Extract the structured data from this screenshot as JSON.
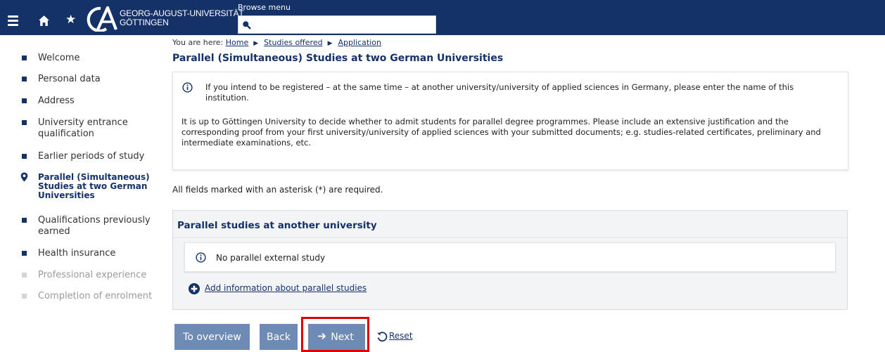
{
  "header": {
    "university_name_line1": "GEORG-AUGUST-UNIVERSITÄT",
    "university_name_line2": "GÖTTINGEN",
    "browse_label": "Browse menu",
    "search_value": "",
    "logo_icon": "university-logo",
    "home_icon": "home-icon",
    "favorite_icon": "star-icon",
    "menu_icon": "hamburger-icon"
  },
  "breadcrumb": {
    "prefix": "You are here:",
    "items": [
      "Home",
      "Studies offered",
      "Application"
    ]
  },
  "page": {
    "title": "Parallel (Simultaneous) Studies at two German Universities",
    "required_note": "All fields marked with an asterisk (*) are required."
  },
  "sidebar": {
    "items": [
      {
        "label": "Welcome",
        "state": "done"
      },
      {
        "label": "Personal data",
        "state": "done"
      },
      {
        "label": "Address",
        "state": "done"
      },
      {
        "label": "University entrance qualification",
        "state": "done"
      },
      {
        "label": "Earlier periods of study",
        "state": "done"
      },
      {
        "label": "Parallel (Simultaneous) Studies at two German Universities",
        "state": "current"
      },
      {
        "label": "Qualifications previously earned",
        "state": "done"
      },
      {
        "label": "Health insurance",
        "state": "done"
      },
      {
        "label": "Professional experience",
        "state": "disabled"
      },
      {
        "label": "Completion of enrolment",
        "state": "disabled"
      }
    ]
  },
  "info_panel": {
    "text1": "If you intend to be registered – at the same time – at another university/university of applied sciences in Germany, please enter the name of this institution.",
    "text2": "It is up to Göttingen University to decide whether to admit students for parallel degree programmes. Please include an extensive justification and the corresponding proof from your first university/university of applied sciences with your submitted documents; e.g. studies-related certificates, preliminary and intermediate examinations, etc."
  },
  "parallel_section": {
    "title": "Parallel studies at another university",
    "empty_message": "No parallel external study",
    "add_link": "Add information about parallel studies"
  },
  "buttons": {
    "overview": "To overview",
    "back": "Back",
    "next": "Next",
    "reset": "Reset"
  },
  "colors": {
    "header_bg": "#153268",
    "accent": "#153268",
    "button_bg": "#6d8bb4",
    "highlight": "#e00000"
  }
}
